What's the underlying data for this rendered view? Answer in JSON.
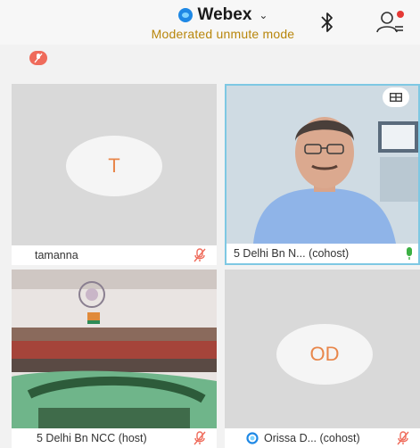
{
  "header": {
    "app_title": "Webex",
    "meeting_mode": "Moderated unmute mode",
    "icons": [
      "webex-logo-icon",
      "chevron-down-icon",
      "bluetooth-icon",
      "participants-icon"
    ]
  },
  "tiles": [
    {
      "name": "tamanna",
      "avatar_initials": "T",
      "audio": "muted"
    },
    {
      "name": "5 Delhi Bn N... (cohost)",
      "audio": "unmuted",
      "video": "on"
    },
    {
      "name": "5 Delhi Bn NCC (host)",
      "audio": "muted",
      "video": "on"
    },
    {
      "name": "Orissa D... (cohost)",
      "avatar_initials": "OD",
      "audio": "muted"
    }
  ],
  "colors": {
    "accent_mode": "#b8860b",
    "mute_red": "#ef6b5b",
    "webex_blue": "#1e88e5",
    "active_border": "#7ec8e3",
    "unmuted_green": "#3cb043"
  }
}
